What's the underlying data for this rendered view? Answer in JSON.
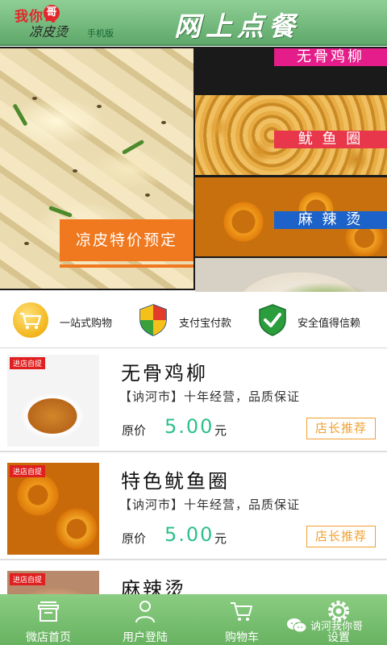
{
  "header": {
    "logo_text": "我你哥",
    "logo_char": "哥",
    "logo_script": "凉皮烫",
    "logo_subtitle": "手机版",
    "title": "网上点餐"
  },
  "banner": {
    "main_label": "凉皮特价预定",
    "items": [
      {
        "label": "无骨鸡柳",
        "color": "#e51d8a"
      },
      {
        "label": "鱿 鱼 圈",
        "color": "#e8364a"
      },
      {
        "label": "麻 辣 烫",
        "color": "#1c62c8"
      }
    ]
  },
  "features": [
    {
      "label": "一站式购物",
      "icon": "shopping-cart-icon"
    },
    {
      "label": "支付宝付款",
      "icon": "shield-icon"
    },
    {
      "label": "安全值得信赖",
      "icon": "check-shield-icon"
    }
  ],
  "products": [
    {
      "badge": "进店自提",
      "name": "无骨鸡柳",
      "desc": "【讷河市】十年经营，品质保证",
      "price_label": "原价",
      "price": "5.00",
      "unit": "元",
      "recommend": "店长推荐"
    },
    {
      "badge": "进店自提",
      "name": "特色鱿鱼圈",
      "desc": "【讷河市】十年经营，品质保证",
      "price_label": "原价",
      "price": "5.00",
      "unit": "元",
      "recommend": "店长推荐"
    },
    {
      "badge": "进店自提",
      "name": "麻辣烫"
    }
  ],
  "tabbar": {
    "tabs": [
      {
        "label": "微店首页",
        "icon": "storefront-icon"
      },
      {
        "label": "用户登陆",
        "icon": "user-icon"
      },
      {
        "label": "购物车",
        "icon": "cart-icon"
      },
      {
        "label": "设置",
        "icon": "gear-icon"
      }
    ],
    "wechat_label": "讷河我你哥"
  },
  "colors": {
    "header_green": "#6fb879",
    "accent_orange": "#f0781e",
    "price_green": "#2cc08a",
    "recommend_orange": "#f0a030"
  }
}
